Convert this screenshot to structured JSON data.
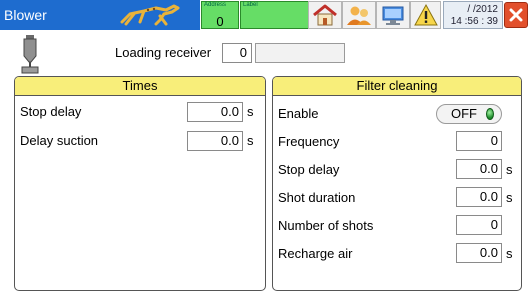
{
  "titlebar": {
    "title": "Blower",
    "address_caption": "Address",
    "address_value": "0",
    "label_caption": "Label",
    "clock_date": "/ /2012",
    "clock_time": "14 :56 : 39"
  },
  "receiver": {
    "label": "Loading receiver",
    "number": "0",
    "name": ""
  },
  "times": {
    "title": "Times",
    "rows": [
      {
        "label": "Stop delay",
        "value": "0.0",
        "unit": "s"
      },
      {
        "label": "Delay suction",
        "value": "0.0",
        "unit": "s"
      }
    ]
  },
  "filter": {
    "title": "Filter cleaning",
    "enable_label": "Enable",
    "enable_state": "OFF",
    "rows": [
      {
        "label": "Frequency",
        "value": "0",
        "unit": ""
      },
      {
        "label": "Stop delay",
        "value": "0.0",
        "unit": "s"
      },
      {
        "label": "Shot duration",
        "value": "0.0",
        "unit": "s"
      },
      {
        "label": "Number of shots",
        "value": "0",
        "unit": ""
      },
      {
        "label": "Recharge air",
        "value": "0.0",
        "unit": "s"
      }
    ]
  },
  "icons": {
    "logo": "animal-logo-icon",
    "home": "home-icon",
    "users": "users-icon",
    "computer": "computer-icon",
    "warning": "warning-icon",
    "close": "close-icon",
    "receiver": "loading-receiver-icon"
  },
  "colors": {
    "title_blue": "#1e6ccf",
    "status_green": "#66dd66",
    "panel_header": "#f8ee7a",
    "close_red": "#e2502c"
  }
}
